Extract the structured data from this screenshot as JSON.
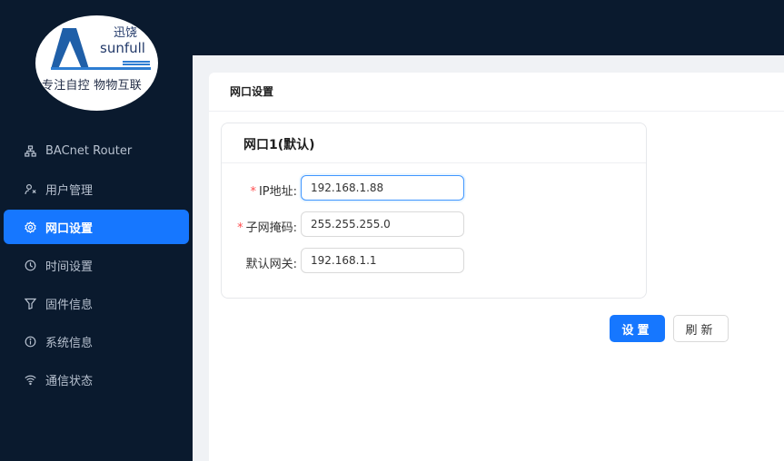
{
  "logo": {
    "cn_name": "迅饶",
    "brand": "sunfull",
    "slogan": "专注自控 物物互联"
  },
  "sidebar": {
    "items": [
      {
        "label": "BACnet Router",
        "icon": "network-icon",
        "active": false
      },
      {
        "label": "用户管理",
        "icon": "user-management-icon",
        "active": false
      },
      {
        "label": "网口设置",
        "icon": "gear-icon",
        "active": true
      },
      {
        "label": "时间设置",
        "icon": "clock-icon",
        "active": false
      },
      {
        "label": "固件信息",
        "icon": "filter-icon",
        "active": false
      },
      {
        "label": "系统信息",
        "icon": "info-icon",
        "active": false
      },
      {
        "label": "通信状态",
        "icon": "wifi-icon",
        "active": false
      }
    ]
  },
  "page": {
    "title": "网口设置"
  },
  "card": {
    "title": "网口1(默认)"
  },
  "form": {
    "ip": {
      "label": "IP地址:",
      "required": true,
      "value": "192.168.1.88"
    },
    "mask": {
      "label": "子网掩码:",
      "required": true,
      "value": "255.255.255.0"
    },
    "gateway": {
      "label": "默认网关:",
      "required": false,
      "value": "192.168.1.1"
    }
  },
  "buttons": {
    "set_label": "设置",
    "refresh_label": "刷新"
  },
  "colors": {
    "sidebar_bg": "#0a1a2e",
    "accent": "#1677ff",
    "required": "#ff4d4f"
  }
}
